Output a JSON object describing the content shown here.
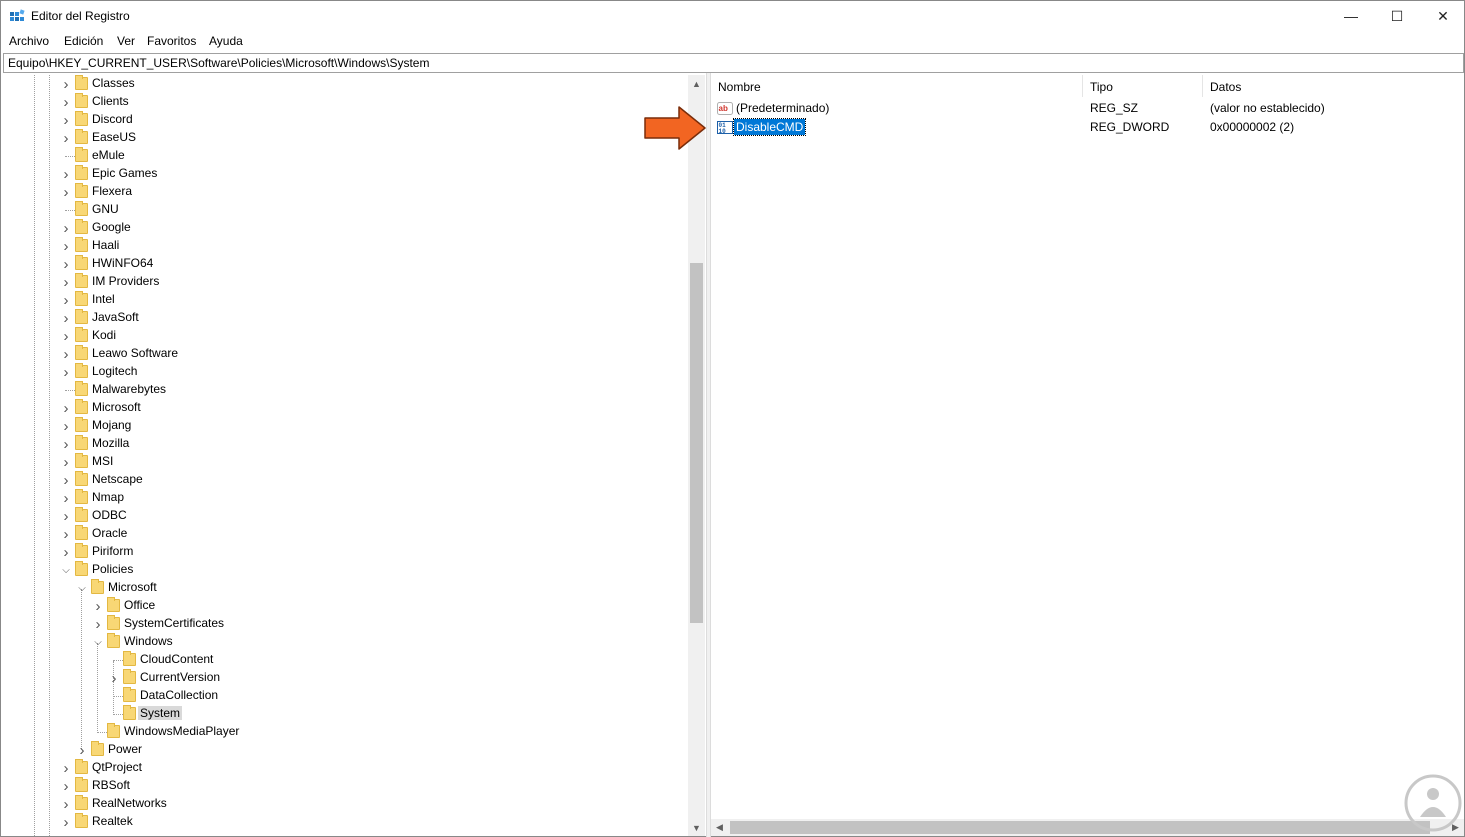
{
  "window": {
    "title": "Editor del Registro",
    "controls": {
      "minimize": "—",
      "maximize": "☐",
      "close": "✕"
    }
  },
  "menu": [
    "Archivo",
    "Edición",
    "Ver",
    "Favoritos",
    "Ayuda"
  ],
  "address": "Equipo\\HKEY_CURRENT_USER\\Software\\Policies\\Microsoft\\Windows\\System",
  "tree": {
    "items": [
      {
        "label": "Classes",
        "expander": "collapsed"
      },
      {
        "label": "Clients",
        "expander": "collapsed"
      },
      {
        "label": "Discord",
        "expander": "collapsed"
      },
      {
        "label": "EaseUS",
        "expander": "collapsed"
      },
      {
        "label": "eMule",
        "expander": "none"
      },
      {
        "label": "Epic Games",
        "expander": "collapsed"
      },
      {
        "label": "Flexera",
        "expander": "collapsed"
      },
      {
        "label": "GNU",
        "expander": "none"
      },
      {
        "label": "Google",
        "expander": "collapsed"
      },
      {
        "label": "Haali",
        "expander": "collapsed"
      },
      {
        "label": "HWiNFO64",
        "expander": "collapsed"
      },
      {
        "label": "IM Providers",
        "expander": "collapsed"
      },
      {
        "label": "Intel",
        "expander": "collapsed"
      },
      {
        "label": "JavaSoft",
        "expander": "collapsed"
      },
      {
        "label": "Kodi",
        "expander": "collapsed"
      },
      {
        "label": "Leawo Software",
        "expander": "collapsed"
      },
      {
        "label": "Logitech",
        "expander": "collapsed"
      },
      {
        "label": "Malwarebytes",
        "expander": "none"
      },
      {
        "label": "Microsoft",
        "expander": "collapsed"
      },
      {
        "label": "Mojang",
        "expander": "collapsed"
      },
      {
        "label": "Mozilla",
        "expander": "collapsed"
      },
      {
        "label": "MSI",
        "expander": "collapsed"
      },
      {
        "label": "Netscape",
        "expander": "collapsed"
      },
      {
        "label": "Nmap",
        "expander": "collapsed"
      },
      {
        "label": "ODBC",
        "expander": "collapsed"
      },
      {
        "label": "Oracle",
        "expander": "collapsed"
      },
      {
        "label": "Piriform",
        "expander": "collapsed"
      },
      {
        "label": "Policies",
        "expander": "expanded"
      },
      {
        "label": "Microsoft",
        "expander": "expanded"
      },
      {
        "label": "Office",
        "expander": "collapsed"
      },
      {
        "label": "SystemCertificates",
        "expander": "collapsed"
      },
      {
        "label": "Windows",
        "expander": "expanded"
      },
      {
        "label": "CloudContent",
        "expander": "none"
      },
      {
        "label": "CurrentVersion",
        "expander": "collapsed"
      },
      {
        "label": "DataCollection",
        "expander": "none"
      },
      {
        "label": "System",
        "expander": "none",
        "selected": true
      },
      {
        "label": "WindowsMediaPlayer",
        "expander": "none"
      },
      {
        "label": "Power",
        "expander": "collapsed"
      },
      {
        "label": "QtProject",
        "expander": "collapsed"
      },
      {
        "label": "RBSoft",
        "expander": "collapsed"
      },
      {
        "label": "RealNetworks",
        "expander": "collapsed"
      },
      {
        "label": "Realtek",
        "expander": "collapsed"
      }
    ]
  },
  "values": {
    "columns": {
      "name": "Nombre",
      "type": "Tipo",
      "data": "Datos"
    },
    "rows": [
      {
        "name": "(Predeterminado)",
        "type": "REG_SZ",
        "data": "(valor no establecido)",
        "icon": "string-value-icon",
        "selected": false
      },
      {
        "name": "DisableCMD",
        "type": "REG_DWORD",
        "data": "0x00000002 (2)",
        "icon": "dword-value-icon",
        "selected": true
      }
    ]
  },
  "colors": {
    "selection": "#0078d7",
    "folder": "#f8d775",
    "annotation_arrow": "#f26522"
  }
}
